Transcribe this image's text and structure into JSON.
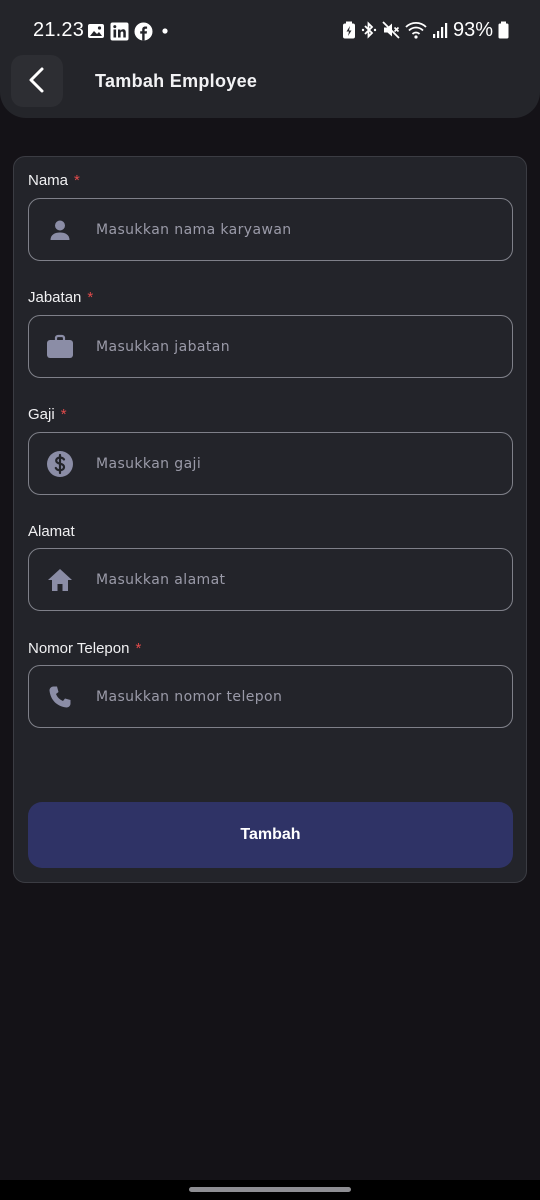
{
  "status_bar": {
    "time": "21.23",
    "battery": "93%",
    "left_icons": [
      "gallery-icon",
      "linkedin-icon",
      "facebook-icon",
      "dot-icon"
    ],
    "right_icons": [
      "battery-saver-icon",
      "bluetooth-icon",
      "mute-icon",
      "wifi-icon",
      "signal-icon",
      "battery-icon"
    ]
  },
  "header": {
    "title": "Tambah Employee",
    "back_icon": "chevron-left-icon"
  },
  "form": {
    "fields": [
      {
        "label": "Nama",
        "required": "*",
        "placeholder": "Masukkan nama karyawan",
        "icon": "person-icon"
      },
      {
        "label": "Jabatan",
        "required": "*",
        "placeholder": "Masukkan jabatan",
        "icon": "briefcase-icon"
      },
      {
        "label": "Gaji",
        "required": "*",
        "placeholder": "Masukkan gaji",
        "icon": "dollar-icon"
      },
      {
        "label": "Alamat",
        "required": "",
        "placeholder": "Masukkan alamat",
        "icon": "home-icon"
      },
      {
        "label": "Nomor Telepon",
        "required": "*",
        "placeholder": "Masukkan nomor telepon",
        "icon": "phone-icon"
      }
    ],
    "submit_label": "Tambah"
  },
  "colors": {
    "background": "#141217",
    "card": "#23242a",
    "button": "#2f3366",
    "required": "#e24b4b",
    "icon": "#8b8da6"
  }
}
